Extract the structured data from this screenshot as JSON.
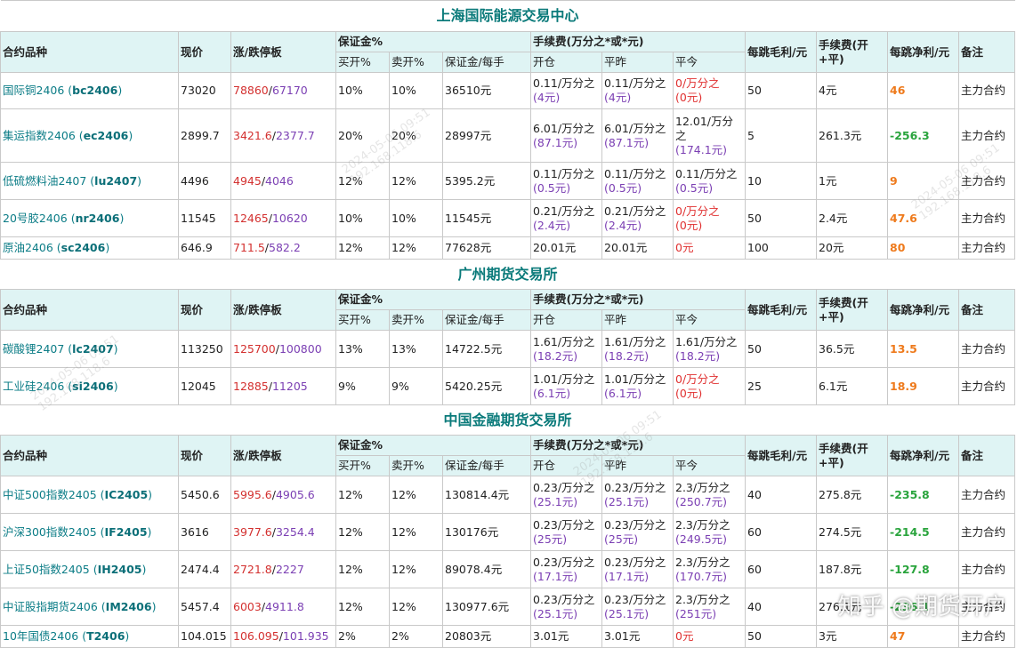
{
  "headers": {
    "name": "合约品种",
    "price": "现价",
    "limit": "涨/跌停板",
    "margin": "保证金%",
    "buy_open": "买开%",
    "sell_open": "卖开%",
    "margin_per": "保证金/每手",
    "fee": "手续费(万分之*或*元)",
    "fee_open": "开仓",
    "fee_close": "平昨",
    "fee_today": "平今",
    "tick_gross": "每跳毛利/元",
    "fee_total": "手续费(开+平)",
    "tick_net": "每跳净利/元",
    "note": "备注"
  },
  "sections": [
    {
      "title": "上海国际能源交易中心",
      "rows": [
        {
          "name": "国际铜2406 (",
          "code": "bc2406",
          "close": ")",
          "price": "73020",
          "up": "78860",
          "sep": "/",
          "down": "67170",
          "buy": "10%",
          "sell": "10%",
          "margin": "36510元",
          "open": [
            "0.11/万分之",
            "(4元)"
          ],
          "close_y": [
            "0.11/万分之",
            "(4元)"
          ],
          "close_t": [
            "0/万分之",
            "(0元)"
          ],
          "today_free": true,
          "gross": "50",
          "total": "4元",
          "net": "46",
          "net_pos": true,
          "note": "主力合约",
          "h": 40
        },
        {
          "name": "集运指数2406 (",
          "code": "ec2406",
          "close": ")",
          "price": "2899.7",
          "up": "3421.6",
          "sep": "/",
          "down": "2377.7",
          "buy": "20%",
          "sell": "20%",
          "margin": "28997元",
          "open": [
            "6.01/万分之",
            "(87.1元)"
          ],
          "close_y": [
            "6.01/万分之",
            "(87.1元)"
          ],
          "close_t": [
            "12.01/万分",
            "之",
            "(174.1元)"
          ],
          "today_free": false,
          "gross": "5",
          "total": "261.3元",
          "net": "-256.3",
          "net_pos": false,
          "note": "主力合约",
          "h": 59
        },
        {
          "name": "低硫燃料油2407 (",
          "code": "lu2407",
          "close": ")",
          "price": "4496",
          "up": "4945",
          "sep": "/",
          "down": "4046",
          "buy": "12%",
          "sell": "12%",
          "margin": "5395.2元",
          "open": [
            "0.11/万分之",
            "(0.5元)"
          ],
          "close_y": [
            "0.11/万分之",
            "(0.5元)"
          ],
          "close_t": [
            "0.11/万分之",
            "(0.5元)"
          ],
          "today_free": false,
          "gross": "10",
          "total": "1元",
          "net": "9",
          "net_pos": true,
          "note": "主力合约",
          "h": 41
        },
        {
          "name": "20号胶2406 (",
          "code": "nr2406",
          "close": ")",
          "price": "11545",
          "up": "12465",
          "sep": "/",
          "down": "10620",
          "buy": "10%",
          "sell": "10%",
          "margin": "11545元",
          "open": [
            "0.21/万分之",
            "(2.4元)"
          ],
          "close_y": [
            "0.21/万分之",
            "(2.4元)"
          ],
          "close_t": [
            "0/万分之",
            "(0元)"
          ],
          "today_free": true,
          "gross": "50",
          "total": "2.4元",
          "net": "47.6",
          "net_pos": true,
          "note": "主力合约",
          "h": 41
        },
        {
          "name": "原油2406 (",
          "code": "sc2406",
          "close": ")",
          "price": "646.9",
          "up": "711.5",
          "sep": "/",
          "down": "582.2",
          "buy": "12%",
          "sell": "12%",
          "margin": "77628元",
          "open": [
            "20.01元"
          ],
          "close_y": [
            "20.01元"
          ],
          "close_t": [
            "0元"
          ],
          "today_free": true,
          "gross": "100",
          "total": "20元",
          "net": "80",
          "net_pos": true,
          "note": "主力合约",
          "h": 24
        }
      ]
    },
    {
      "title": "广州期货交易所",
      "rows": [
        {
          "name": "碳酸锂2407 (",
          "code": "lc2407",
          "close": ")",
          "price": "113250",
          "up": "125700",
          "sep": "/",
          "down": "100800",
          "buy": "13%",
          "sell": "13%",
          "margin": "14722.5元",
          "open": [
            "1.61/万分之",
            "(18.2元)"
          ],
          "close_y": [
            "1.61/万分之",
            "(18.2元)"
          ],
          "close_t": [
            "1.61/万分之",
            "(18.2元)"
          ],
          "today_free": false,
          "gross": "50",
          "total": "36.5元",
          "net": "13.5",
          "net_pos": true,
          "note": "主力合约",
          "h": 41
        },
        {
          "name": "工业硅2406 (",
          "code": "si2406",
          "close": ")",
          "price": "12045",
          "up": "12885",
          "sep": "/",
          "down": "11205",
          "buy": "9%",
          "sell": "9%",
          "margin": "5420.25元",
          "open": [
            "1.01/万分之",
            "(6.1元)"
          ],
          "close_y": [
            "1.01/万分之",
            "(6.1元)"
          ],
          "close_t": [
            "0/万分之",
            "(0元)"
          ],
          "today_free": true,
          "gross": "25",
          "total": "6.1元",
          "net": "18.9",
          "net_pos": true,
          "note": "主力合约",
          "h": 41
        }
      ]
    },
    {
      "title": "中国金融期货交易所",
      "rows": [
        {
          "name": "中证500指数2405 (",
          "code": "IC2405",
          "close": ")",
          "price": "5450.6",
          "up": "5995.6",
          "sep": "/",
          "down": "4905.6",
          "buy": "12%",
          "sell": "12%",
          "margin": "130814.4元",
          "open": [
            "0.23/万分之",
            "(25.1元)"
          ],
          "close_y": [
            "0.23/万分之",
            "(25.1元)"
          ],
          "close_t": [
            "2.3/万分之",
            "(250.7元)"
          ],
          "today_free": false,
          "gross": "40",
          "total": "275.8元",
          "net": "-235.8",
          "net_pos": false,
          "note": "主力合约",
          "h": 41
        },
        {
          "name": "沪深300指数2405 (",
          "code": "IF2405",
          "close": ")",
          "price": "3616",
          "up": "3977.6",
          "sep": "/",
          "down": "3254.4",
          "buy": "12%",
          "sell": "12%",
          "margin": "130176元",
          "open": [
            "0.23/万分之",
            "(25元)"
          ],
          "close_y": [
            "0.23/万分之",
            "(25元)"
          ],
          "close_t": [
            "2.3/万分之",
            "(249.5元)"
          ],
          "today_free": false,
          "gross": "60",
          "total": "274.5元",
          "net": "-214.5",
          "net_pos": false,
          "note": "主力合约",
          "h": 41
        },
        {
          "name": "上证50指数2405 (",
          "code": "IH2405",
          "close": ")",
          "price": "2474.4",
          "up": "2721.8",
          "sep": "/",
          "down": "2227",
          "buy": "12%",
          "sell": "12%",
          "margin": "89078.4元",
          "open": [
            "0.23/万分之",
            "(17.1元)"
          ],
          "close_y": [
            "0.23/万分之",
            "(17.1元)"
          ],
          "close_t": [
            "2.3/万分之",
            "(170.7元)"
          ],
          "today_free": false,
          "gross": "60",
          "total": "187.8元",
          "net": "-127.8",
          "net_pos": false,
          "note": "主力合约",
          "h": 41
        },
        {
          "name": "中证股指期货2406 (",
          "code": "IM2406",
          "close": ")",
          "price": "5457.4",
          "up": "6003",
          "sep": "/",
          "down": "4911.8",
          "buy": "12%",
          "sell": "12%",
          "margin": "130977.6元",
          "open": [
            "0.23/万分之",
            "(25.1元)"
          ],
          "close_y": [
            "0.23/万分之",
            "(25.1元)"
          ],
          "close_t": [
            "2.3/万分之",
            "(251元)"
          ],
          "today_free": false,
          "gross": "40",
          "total": "276.1元",
          "net": "-236.1",
          "net_pos": false,
          "note": "主力合约",
          "h": 41
        },
        {
          "name": "10年国债2406 (",
          "code": "T2406",
          "close": ")",
          "price": "104.015",
          "up": "106.095",
          "sep": "/",
          "down": "101.935",
          "buy": "2%",
          "sell": "2%",
          "margin": "20803元",
          "open": [
            "3.01元"
          ],
          "close_y": [
            "3.01元"
          ],
          "close_t": [
            "0元"
          ],
          "today_free": true,
          "gross": "50",
          "total": "3元",
          "net": "47",
          "net_pos": true,
          "note": "主力合约",
          "h": 24
        }
      ]
    }
  ],
  "watermark": {
    "date": "2024-05-06 09:51",
    "ip": "192.168.118.6"
  },
  "overlay": "知乎 @期货开户"
}
